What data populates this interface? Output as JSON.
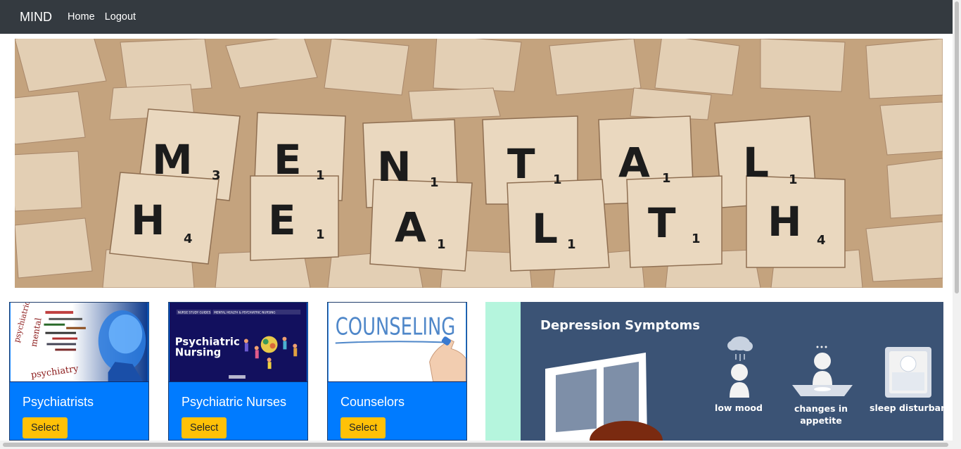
{
  "nav": {
    "brand": "MIND",
    "links": [
      "Home",
      "Logout"
    ]
  },
  "hero": {
    "tiles_row1": [
      "M",
      "E",
      "N",
      "T",
      "A",
      "L"
    ],
    "scores_row1": [
      "3",
      "1",
      "1",
      "1",
      "1",
      "1"
    ],
    "tiles_row2": [
      "H",
      "E",
      "A",
      "L",
      "T",
      "H"
    ],
    "scores_row2": [
      "4",
      "1",
      "1",
      "1",
      "1",
      "4"
    ]
  },
  "cards": [
    {
      "title": "Psychiatrists",
      "button": "Select",
      "image_text": [
        "psychiatric",
        "mental",
        "psychiatry"
      ]
    },
    {
      "title": "Psychiatric Nurses",
      "button": "Select",
      "image_text": [
        "NURSE STUDY GUIDES",
        "MENTAL HEALTH & PSYCHIATRIC NURSING",
        "Psychiatric",
        "Nursing"
      ]
    },
    {
      "title": "Counselors",
      "button": "Select",
      "image_text": [
        "COUNSELING"
      ]
    }
  ],
  "depression": {
    "title": "Depression Symptoms",
    "symptoms": [
      "low mood",
      "changes in",
      "appetite",
      "sleep disturbance"
    ]
  },
  "colors": {
    "navbar": "#343a40",
    "card_body": "#007bff",
    "button": "#ffc107",
    "depr_bg": "#3b5375",
    "depr_accent": "#b5f5dd"
  }
}
